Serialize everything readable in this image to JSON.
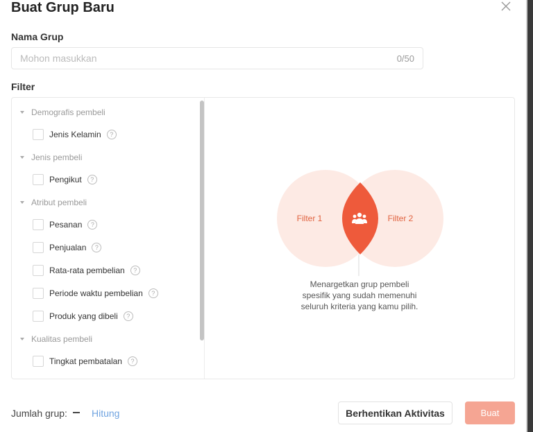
{
  "dialog": {
    "title": "Buat Grup Baru"
  },
  "name_field": {
    "label": "Nama Grup",
    "placeholder": "Mohon masukkan",
    "value": "",
    "counter": "0/50"
  },
  "filter": {
    "label": "Filter",
    "groups": [
      {
        "title": "Demografis pembeli",
        "options": [
          "Jenis Kelamin"
        ]
      },
      {
        "title": "Jenis pembeli",
        "options": [
          "Pengikut"
        ]
      },
      {
        "title": "Atribut pembeli",
        "options": [
          "Pesanan",
          "Penjualan",
          "Rata-rata pembelian",
          "Periode waktu pembelian",
          "Produk yang dibeli"
        ]
      },
      {
        "title": "Kualitas pembeli",
        "options": [
          "Tingkat pembatalan"
        ]
      }
    ],
    "help_icon": "question-circle-icon"
  },
  "venn": {
    "filter1": "Filter 1",
    "filter2": "Filter 2",
    "center_icon": "group-users-icon",
    "desc_lines": [
      "Menargetkan grup pembeli",
      "spesifik yang sudah memenuhi",
      "seluruh kriteria yang kamu pilih."
    ],
    "colors": {
      "circle": "#fde8e1",
      "intersection": "#ee5a3b",
      "label": "#e0623f"
    }
  },
  "footer": {
    "count_label": "Jumlah grup:",
    "count_value": "—",
    "calculate_link": "Hitung",
    "stop_button": "Berhentikan Aktivitas",
    "create_button": "Buat"
  },
  "colors": {
    "accent": "#ee4d2d",
    "create_disabled": "#f5a593",
    "link": "#6fa3e0"
  }
}
